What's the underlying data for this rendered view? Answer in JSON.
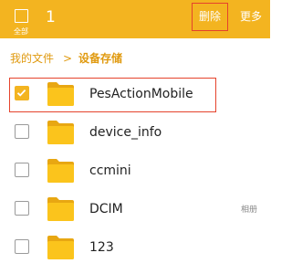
{
  "header": {
    "select_all_label": "全部",
    "selected_count": "1",
    "delete_label": "删除",
    "more_label": "更多"
  },
  "breadcrumb": {
    "home": "我的文件",
    "separator": ">",
    "current": "设备存储"
  },
  "files": [
    {
      "name": "PesActionMobile",
      "checked": true,
      "tag": ""
    },
    {
      "name": "device_info",
      "checked": false,
      "tag": ""
    },
    {
      "name": "ccmini",
      "checked": false,
      "tag": ""
    },
    {
      "name": "DCIM",
      "checked": false,
      "tag": "相册"
    },
    {
      "name": "123",
      "checked": false,
      "tag": ""
    }
  ],
  "colors": {
    "accent": "#f3b420",
    "breadcrumb": "#e09a10",
    "highlight": "#e5432c",
    "folder": "#fbc41c"
  },
  "icons": {
    "folder": "folder-icon",
    "check": "check-icon"
  }
}
